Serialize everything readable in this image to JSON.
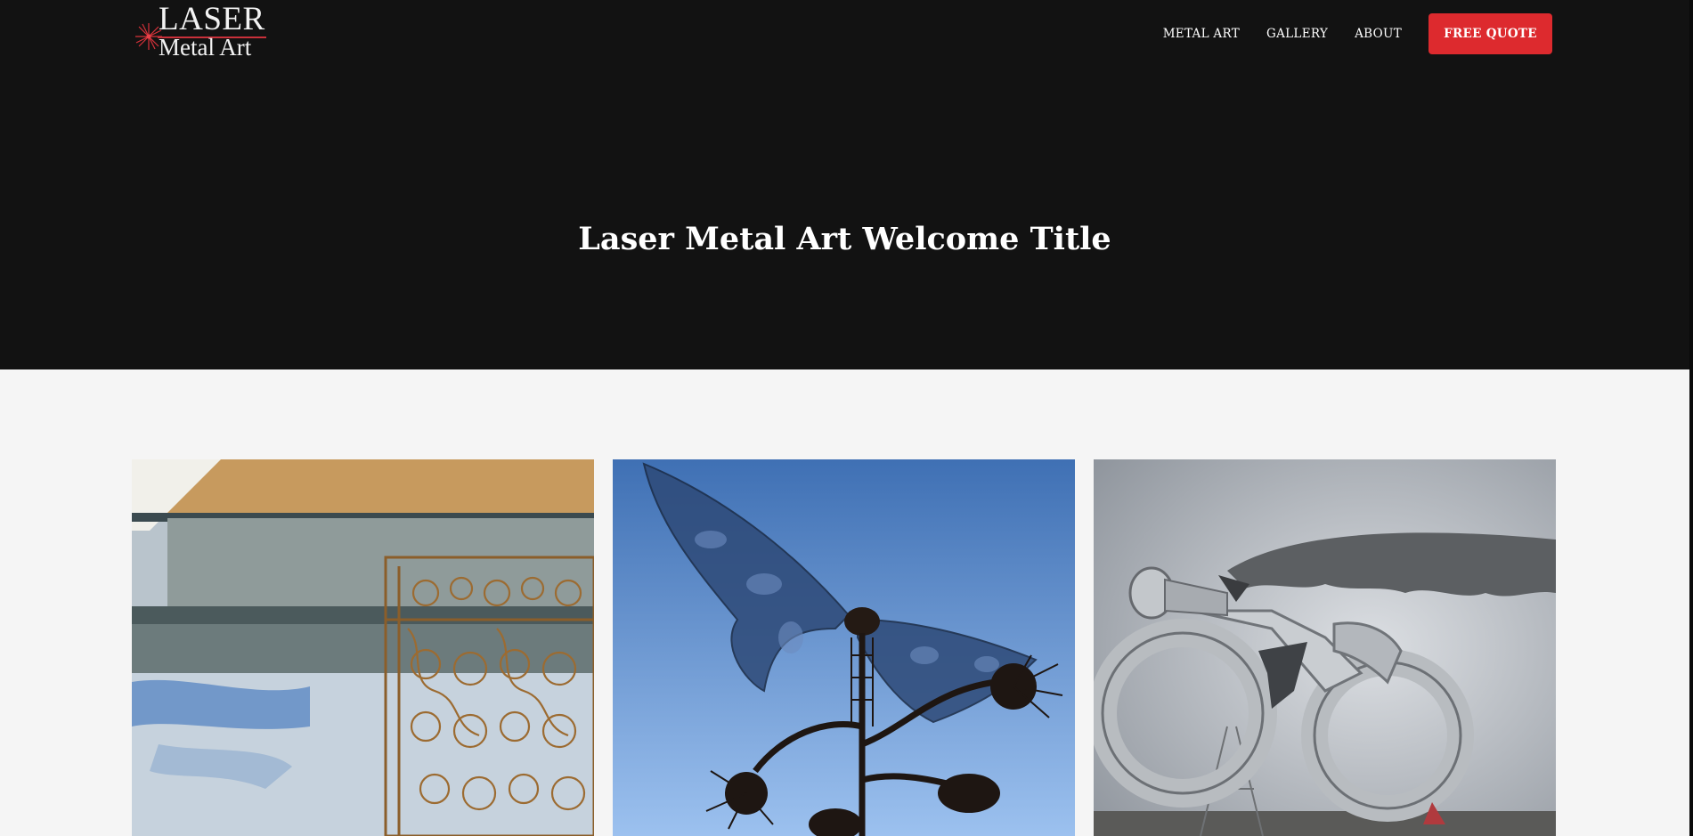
{
  "brand": {
    "logo_line1": "LASER",
    "logo_line2": "Metal Art"
  },
  "nav": {
    "items": [
      {
        "label": "METAL ART"
      },
      {
        "label": "GALLERY"
      },
      {
        "label": "ABOUT"
      }
    ],
    "cta_label": "FREE QUOTE"
  },
  "hero": {
    "title": "Laser Metal Art Welcome Title"
  },
  "gallery": {
    "images": [
      {
        "subject": "ornamental-scroll-box-photo"
      },
      {
        "subject": "metal-butterfly-sculpture-photo"
      },
      {
        "subject": "metal-motorcycle-sculpture-photo"
      }
    ]
  },
  "colors": {
    "header_bg": "#121212",
    "page_bg": "#f5f5f5",
    "accent": "#dd2a2e",
    "text_light": "#ffffff"
  }
}
